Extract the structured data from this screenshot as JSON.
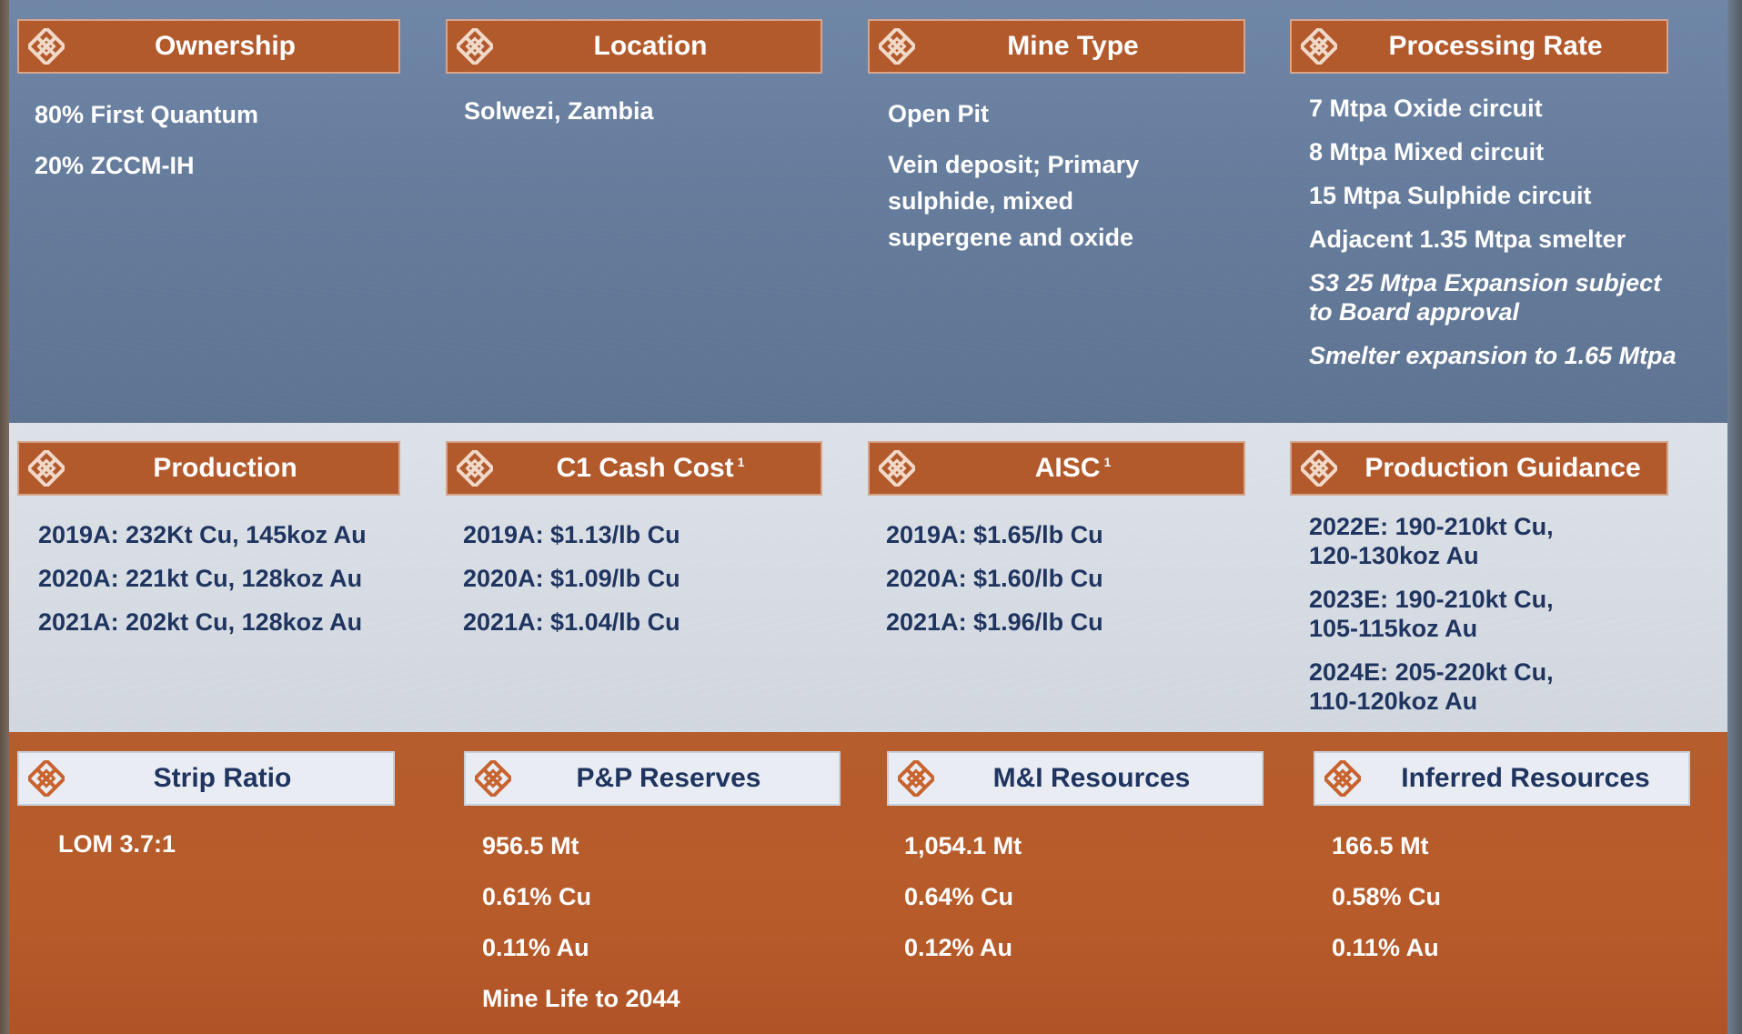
{
  "colors": {
    "header_orange": "#b35a2d",
    "header_light": "#e9edf3",
    "text_navy": "#1f3560",
    "text_white": "#ffffff"
  },
  "icon": "diamond-lattice-icon",
  "top": {
    "ownership": {
      "title": "Ownership",
      "lines": [
        "80% First Quantum",
        "20% ZCCM-IH"
      ]
    },
    "location": {
      "title": "Location",
      "lines": [
        "Solwezi, Zambia"
      ]
    },
    "mine_type": {
      "title": "Mine Type",
      "lines": [
        "Open Pit",
        "Vein deposit; Primary",
        "sulphide, mixed",
        "supergene and oxide"
      ]
    },
    "processing_rate": {
      "title": "Processing Rate",
      "lines": [
        "7 Mtpa Oxide circuit",
        "8 Mtpa Mixed circuit",
        "15 Mtpa Sulphide circuit",
        "Adjacent 1.35 Mtpa smelter"
      ],
      "italic_lines": [
        "S3 25 Mtpa Expansion subject",
        "to Board approval",
        "Smelter expansion to 1.65 Mtpa"
      ]
    }
  },
  "middle": {
    "production": {
      "title": "Production",
      "lines": [
        "2019A: 232Kt Cu, 145koz Au",
        "2020A: 221kt Cu, 128koz Au",
        "2021A: 202kt Cu, 128koz Au"
      ]
    },
    "c1_cash_cost": {
      "title": "C1 Cash Cost",
      "footnote": "1",
      "lines": [
        "2019A: $1.13/lb Cu",
        "2020A: $1.09/lb Cu",
        "2021A: $1.04/lb Cu"
      ]
    },
    "aisc": {
      "title": "AISC",
      "footnote": "1",
      "lines": [
        "2019A: $1.65/lb Cu",
        "2020A: $1.60/lb Cu",
        "2021A: $1.96/lb Cu"
      ]
    },
    "production_guidance": {
      "title": "Production Guidance",
      "lines": [
        "2022E: 190-210kt Cu,",
        "120-130koz Au",
        "2023E: 190-210kt Cu,",
        "105-115koz Au",
        "2024E: 205-220kt Cu,",
        "110-120koz Au"
      ]
    }
  },
  "bottom": {
    "strip_ratio": {
      "title": "Strip Ratio",
      "lines": [
        "LOM 3.7:1"
      ]
    },
    "pp_reserves": {
      "title": "P&P Reserves",
      "lines": [
        "956.5 Mt",
        "0.61% Cu",
        "0.11% Au",
        "Mine Life to 2044"
      ]
    },
    "mi_resources": {
      "title": "M&I Resources",
      "lines": [
        "1,054.1 Mt",
        "0.64% Cu",
        "0.12% Au"
      ]
    },
    "inferred_resources": {
      "title": "Inferred Resources",
      "lines": [
        "166.5 Mt",
        "0.58% Cu",
        "0.11% Au"
      ]
    }
  }
}
